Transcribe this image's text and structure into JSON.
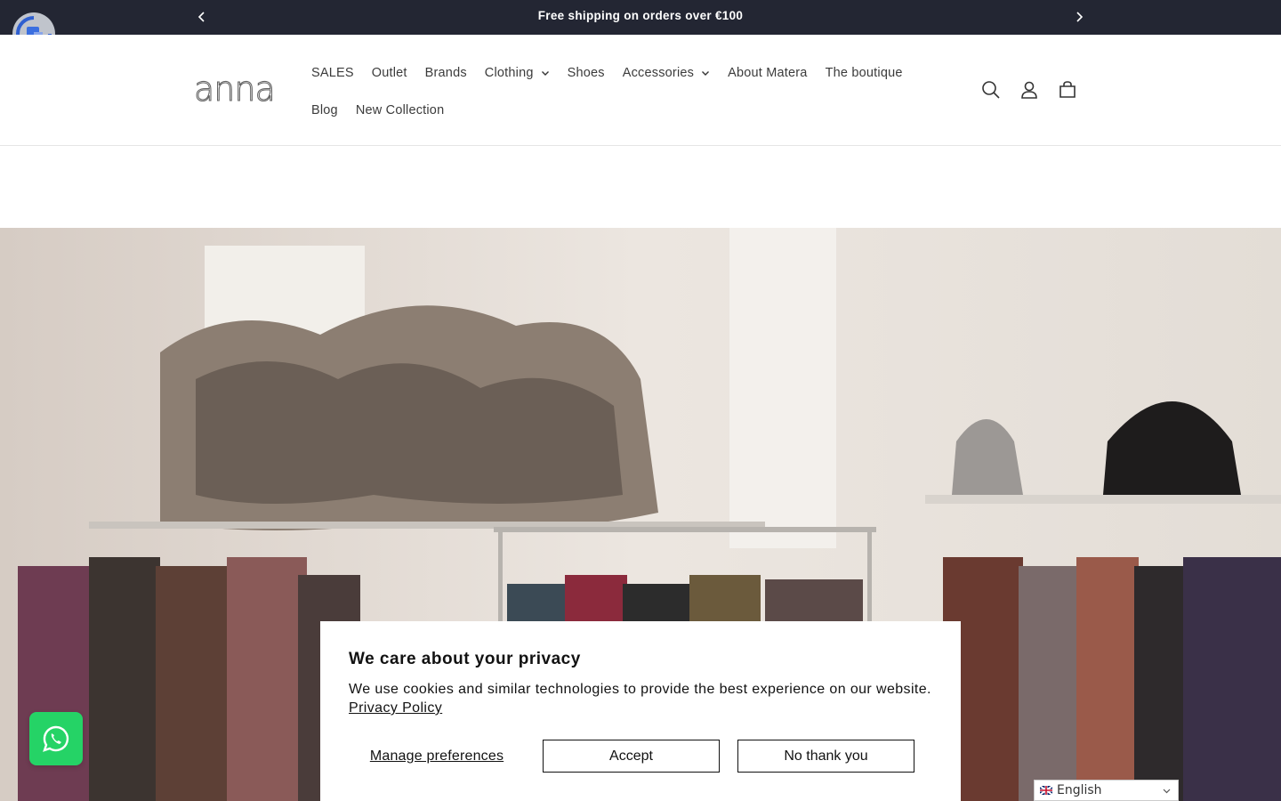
{
  "announcement": {
    "text": "Free shipping on orders over €100",
    "prev_icon": "chevron-left-icon",
    "next_icon": "chevron-right-icon"
  },
  "header": {
    "logo_text": "anna",
    "nav": {
      "row1": [
        {
          "label": "SALES",
          "dropdown": false
        },
        {
          "label": "Outlet",
          "dropdown": false
        },
        {
          "label": "Brands",
          "dropdown": false
        },
        {
          "label": "Clothing",
          "dropdown": true
        },
        {
          "label": "Shoes",
          "dropdown": false
        },
        {
          "label": "Accessories",
          "dropdown": true
        },
        {
          "label": "About Matera",
          "dropdown": false
        },
        {
          "label": "The boutique",
          "dropdown": false
        }
      ],
      "row2": [
        {
          "label": "Blog",
          "dropdown": false
        },
        {
          "label": "New Collection",
          "dropdown": false
        }
      ]
    },
    "icons": [
      "search-icon",
      "account-icon",
      "cart-icon"
    ]
  },
  "cookie_banner": {
    "title": "We care about your privacy",
    "text": "We use cookies and similar technologies to provide the best experience on our website.",
    "link": "Privacy Policy",
    "manage_label": "Manage preferences",
    "accept_label": "Accept",
    "decline_label": "No thank you"
  },
  "language_selector": {
    "selected": "English",
    "flag": "uk-flag-icon"
  },
  "colors": {
    "announcement_bg": "#232633",
    "whatsapp": "#25d366",
    "text": "#121212"
  }
}
